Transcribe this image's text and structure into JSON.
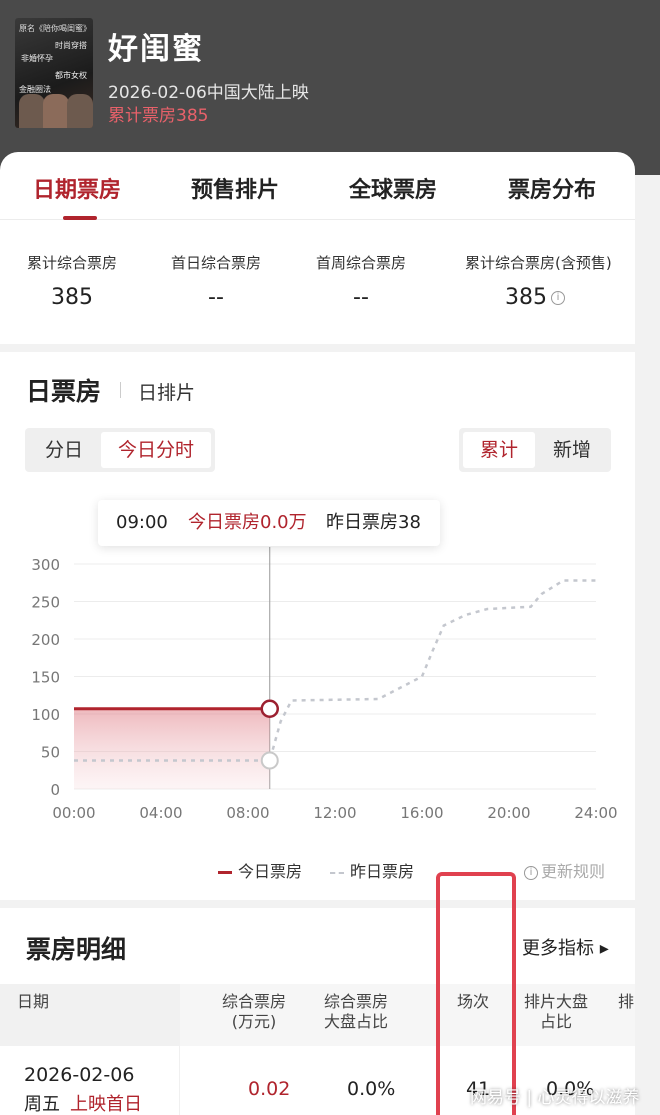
{
  "movie": {
    "title": "好闺蜜",
    "release": "2026-02-06中国大陆上映",
    "cumulative": "累计票房385",
    "poster_text": [
      "原名《陪你喝闺蜜》",
      "时尚穿搭",
      "非婚怀孕",
      "都市女权",
      "金融圈法"
    ]
  },
  "tabs": [
    "日期票房",
    "预售排片",
    "全球票房",
    "票房分布"
  ],
  "stats": [
    {
      "label": "累计综合票房",
      "value": "385"
    },
    {
      "label": "首日综合票房",
      "value": "--"
    },
    {
      "label": "首周综合票房",
      "value": "--"
    },
    {
      "label": "累计综合票房(含预售)",
      "value": "385"
    }
  ],
  "info_glyph": "i",
  "chart_section": {
    "title": "日票房",
    "subtitle": "日排片",
    "mode_options": [
      "分日",
      "今日分时"
    ],
    "mode_selected": "今日分时",
    "value_options": [
      "累计",
      "新增"
    ],
    "value_selected": "累计",
    "tooltip": {
      "time": "09:00",
      "today": "今日票房0.0万",
      "yesterday": "昨日票房38"
    },
    "legend_today": "今日票房",
    "legend_yesterday": "昨日票房",
    "update_rules": "更新规则"
  },
  "chart_data": {
    "type": "line",
    "x_ticks": [
      "00:00",
      "04:00",
      "08:00",
      "12:00",
      "16:00",
      "20:00",
      "24:00"
    ],
    "y_ticks": [
      300,
      250,
      200,
      150,
      100,
      50,
      0
    ],
    "xlim": [
      0,
      24
    ],
    "ylim": [
      0,
      300
    ],
    "grid": true,
    "cursor_x": 9,
    "series": [
      {
        "name": "今日票房",
        "style": "solid",
        "color": "#b0242d",
        "area": true,
        "points": [
          [
            0,
            107
          ],
          [
            9,
            107
          ]
        ]
      },
      {
        "name": "昨日票房",
        "style": "dashed",
        "color": "#c4c7ce",
        "points": [
          [
            0,
            38
          ],
          [
            9,
            38
          ],
          [
            9.5,
            90
          ],
          [
            10,
            118
          ],
          [
            14,
            120
          ],
          [
            15,
            135
          ],
          [
            16,
            150
          ],
          [
            16.5,
            185
          ],
          [
            17,
            218
          ],
          [
            18,
            232
          ],
          [
            19,
            240
          ],
          [
            21,
            243
          ],
          [
            21.5,
            260
          ],
          [
            22.5,
            278
          ],
          [
            24,
            278
          ]
        ]
      }
    ],
    "legend": "bottom"
  },
  "detail": {
    "title": "票房明细",
    "more": "更多指标 ▸",
    "columns": [
      "日期",
      "综合票房\n(万元)",
      "综合票房\n大盘占比",
      "场次",
      "排片大盘\n占比",
      "排"
    ],
    "row": {
      "date": "2026-02-06",
      "weekday": "周五",
      "tag": "上映首日",
      "box": "0.02",
      "share": "0.0%",
      "shows": "41",
      "schedule": "0.0%"
    }
  },
  "watermark": "网易号 | 心灵得以滋养",
  "colors": {
    "accent": "#b0242d",
    "header_bg": "#4a4a4a"
  }
}
